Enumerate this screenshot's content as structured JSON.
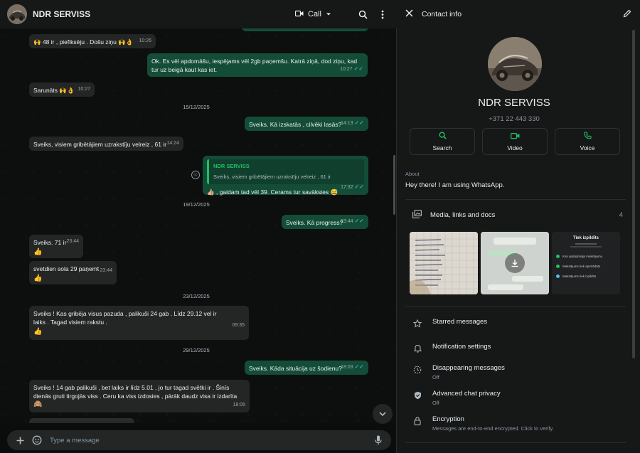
{
  "chat": {
    "contact_name": "NDR SERVISS",
    "call_label": "Call",
    "composer_placeholder": "Type a message",
    "messages": [
      {
        "text": "🙌 48 ir , piefiksēju . Došu ziņu 🙌👌",
        "time": "10:26"
      },
      {
        "text": "Ok. Es vēl apdomāšu, iespējams vēl 2gb paņemšu.  Katrā ziņā, dod ziņu, kad tur uz beigā kaut kas iet.",
        "time": "10:27"
      },
      {
        "text": "Sarunāts 🙌👌",
        "time": "10:27"
      },
      {
        "date": "15/12/2025"
      },
      {
        "text": "Sveiks. Kā izskatās , cilvēki lasās?",
        "time": "14:13"
      },
      {
        "text": "Sveiks, visiem gribētājiem uzrakstīju velreiz , 61 ir",
        "time": "14:24"
      },
      {
        "quote_name": "NDR SERVISS",
        "quote_text": "Sveiks, visiem gribētājiem uzrakstīju velreiz , 61 ir",
        "text": "👍🏼 , gaidam tad vēl 39. Cerams tur savāksies 😅",
        "time": "17:32"
      },
      {
        "date": "19/12/2025"
      },
      {
        "text": "Sveiks. Kā progress?",
        "time": "23:44"
      },
      {
        "text": "Sveiks. 71 ir",
        "emoji": "👍",
        "time": "23:44"
      },
      {
        "text": "svetdien sola 29 paņemt",
        "emoji": "👍",
        "time": "23:44"
      },
      {
        "date": "23/12/2025"
      },
      {
        "text": "Sveiks ! Kas gribēja visus pazuda , palikuši 24 gab . Līdz 29.12 vel ir laiks . Tagad visiem rakstu .",
        "emoji": "👍",
        "time": "09:35"
      },
      {
        "date": "29/12/2025"
      },
      {
        "text": "Sveiks. Kāda situācija uz šodienu?",
        "time": "18:03"
      },
      {
        "text": "Sveiks ! 14 gab palikuši , bet laiks ir līdz 5.01 , jo tur tagad svētki ir . Šinīs dienās gruti tirgojās viss . Ceru ka viss izdosies , pārāk daudz visa ir izdarīta",
        "emoji": "🙈",
        "time": "18:05"
      }
    ]
  },
  "info": {
    "header_title": "Contact info",
    "name": "NDR SERVISS",
    "phone": "+371 22 443 330",
    "actions": [
      "Search",
      "Video",
      "Voice"
    ],
    "about_label": "About",
    "about_text": "Hey there! I am using WhatsApp.",
    "media_label": "Media, links and docs",
    "media_count": "4",
    "thumb3": {
      "title": "Tiek izpildīts",
      "line1": "Kas apstiprināja maksājumu",
      "line2": "Maksājums tiek apstrādāts",
      "line3": "Maksājums tiek izpildīts"
    },
    "items": [
      {
        "title": "Starred messages",
        "sub": ""
      },
      {
        "title": "Notification settings",
        "sub": ""
      },
      {
        "title": "Disappearing messages",
        "sub": "Off"
      },
      {
        "title": "Advanced chat privacy",
        "sub": "Off"
      },
      {
        "title": "Encryption",
        "sub": "Messages are end-to-end encrypted. Click to verify."
      }
    ]
  },
  "colors": {
    "accent": "#21c063",
    "outgoing_bubble": "#144d37",
    "incoming_bubble": "#242626",
    "read_ticks": "#53bdeb"
  }
}
